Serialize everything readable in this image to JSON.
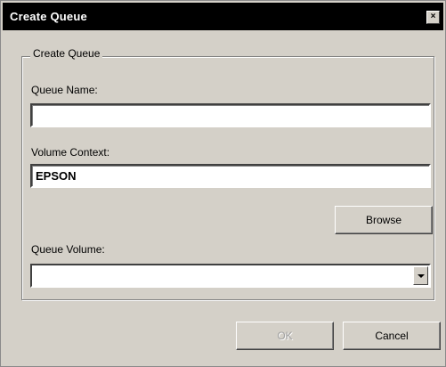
{
  "window": {
    "title": "Create Queue",
    "close_glyph": "×"
  },
  "group": {
    "legend": "Create Queue"
  },
  "fields": {
    "queue_name": {
      "label": "Queue Name:",
      "value": ""
    },
    "volume_context": {
      "label": "Volume Context:",
      "value": "EPSON"
    },
    "queue_volume": {
      "label": "Queue Volume:",
      "value": ""
    }
  },
  "buttons": {
    "browse": "Browse",
    "ok": "OK",
    "cancel": "Cancel"
  },
  "icons": {
    "close": "close-icon",
    "dropdown": "chevron-down-icon"
  }
}
